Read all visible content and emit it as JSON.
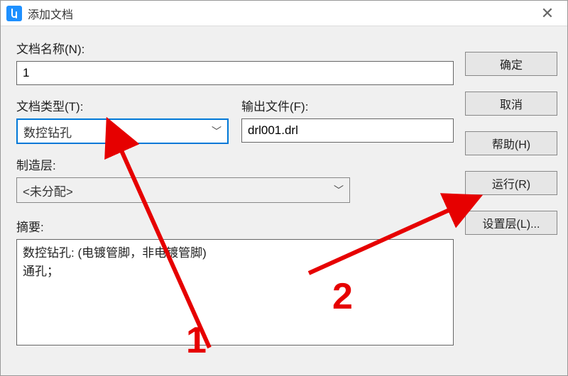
{
  "window": {
    "title": "添加文档"
  },
  "labels": {
    "docName": "文档名称(N):",
    "docType": "文档类型(T):",
    "outputFile": "输出文件(F):",
    "mfgLayer": "制造层:",
    "summary": "摘要:"
  },
  "fields": {
    "docName": "1",
    "docType": "数控钻孔",
    "outputFile": "drl001.drl",
    "mfgLayer": "<未分配>",
    "summaryText": "数控钻孔: (电镀管脚，非电镀管脚)\n通孔；"
  },
  "buttons": {
    "ok": "确定",
    "cancel": "取消",
    "help": "帮助(H)",
    "run": "运行(R)",
    "setLayer": "设置层(L)..."
  },
  "annotations": {
    "one": "1",
    "two": "2"
  }
}
